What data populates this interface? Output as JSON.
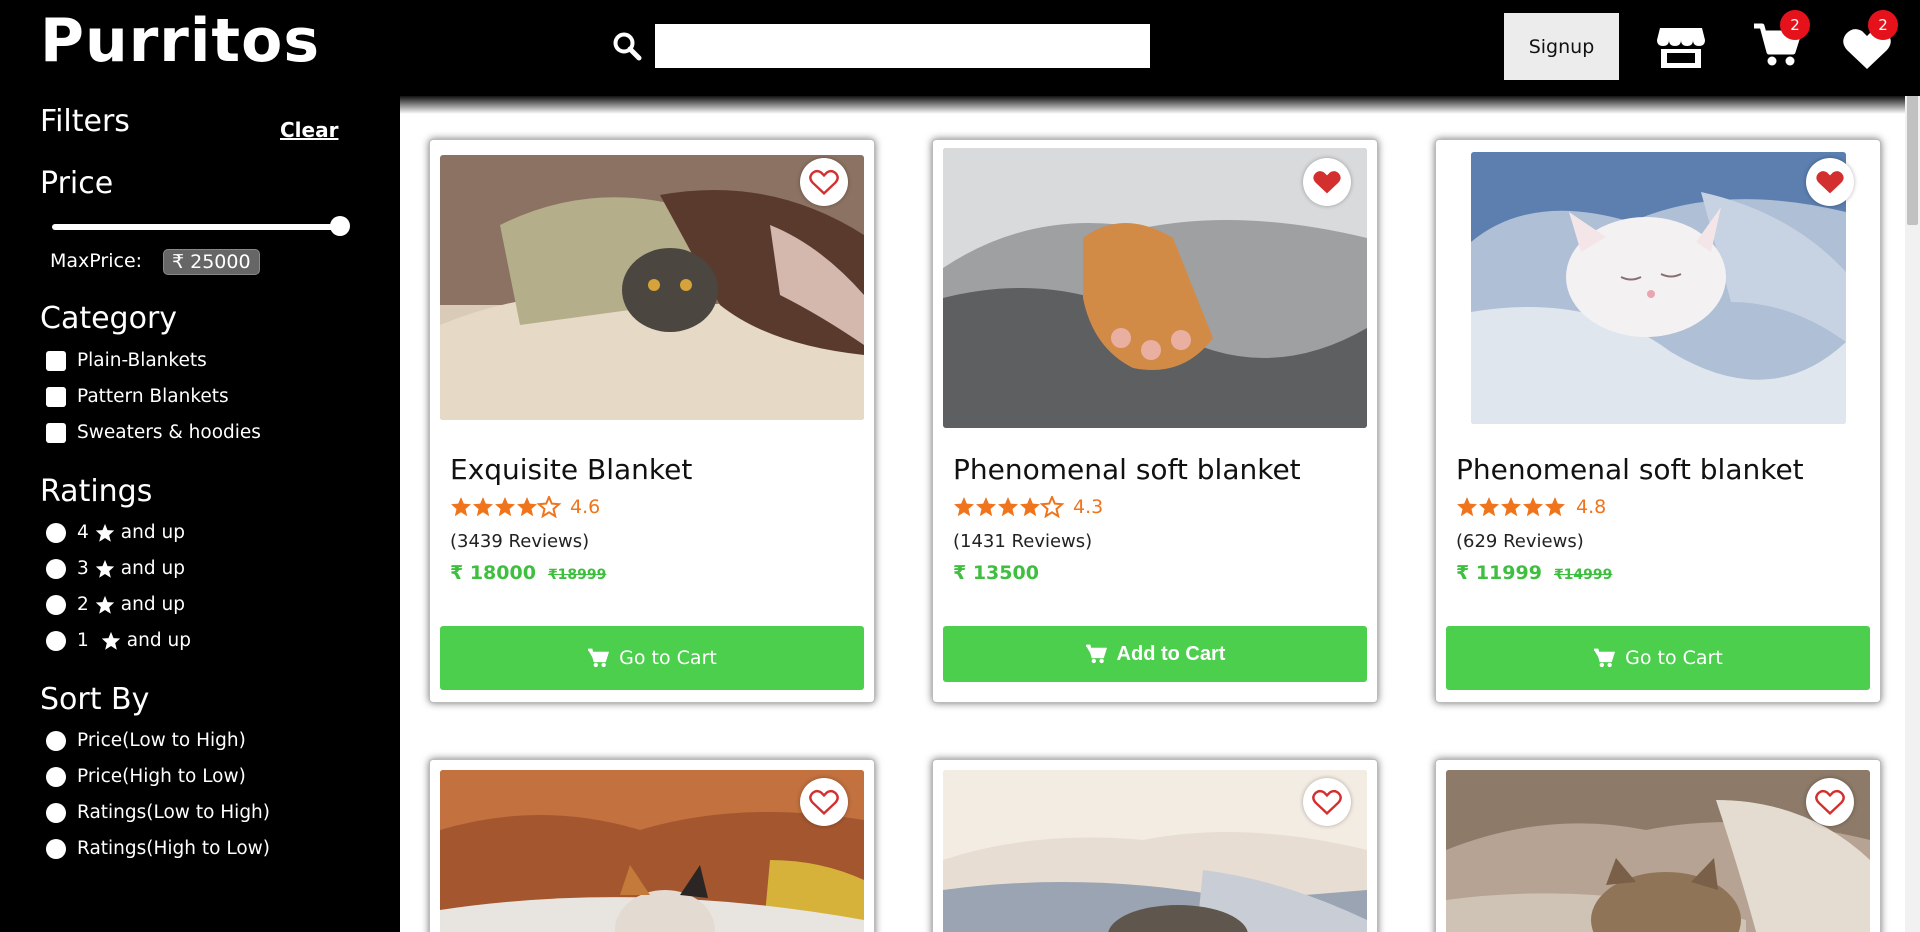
{
  "brand": "Purritos",
  "search": {
    "placeholder": "",
    "value": ""
  },
  "header": {
    "signup_label": "Signup",
    "cart_count": "2",
    "wishlist_count": "2"
  },
  "filters": {
    "title": "Filters",
    "clear_label": "Clear",
    "price": {
      "title": "Price",
      "max_label": "MaxPrice:",
      "max_value": "₹ 25000"
    },
    "category": {
      "title": "Category",
      "options": [
        "Plain-Blankets",
        "Pattern Blankets",
        "Sweaters & hoodies"
      ]
    },
    "ratings": {
      "title": "Ratings",
      "options": [
        {
          "num": "4",
          "suffix": "and up"
        },
        {
          "num": "3",
          "suffix": "and up"
        },
        {
          "num": "2",
          "suffix": "and up"
        },
        {
          "num": "1",
          "suffix": "and up"
        }
      ]
    },
    "sort": {
      "title": "Sort By",
      "options": [
        "Price(Low to High)",
        "Price(High to Low)",
        "Ratings(Low to High)",
        "Ratings(High to Low)"
      ]
    }
  },
  "products": [
    {
      "title": "Exquisite Blanket",
      "rating": "4.6",
      "reviews": "(3439 Reviews)",
      "price": "₹ 18000",
      "old_price": "₹18999",
      "button": "Go to Cart",
      "favorited": false
    },
    {
      "title": "Phenomenal soft blanket",
      "rating": "4.3",
      "reviews": "(1431 Reviews)",
      "price": "₹ 13500",
      "old_price": "",
      "button": "Add to Cart",
      "favorited": true
    },
    {
      "title": "Phenomenal soft blanket",
      "rating": "4.8",
      "reviews": "(629 Reviews)",
      "price": "₹ 11999",
      "old_price": "₹14999",
      "button": "Go to Cart",
      "favorited": true
    }
  ],
  "colors": {
    "accent_green": "#4ccf4c",
    "rating_orange": "#f0741b",
    "heart_red": "#d32f2f",
    "badge_red": "#e5121c"
  }
}
